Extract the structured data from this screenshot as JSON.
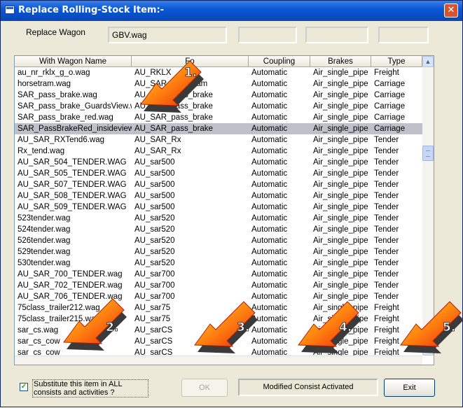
{
  "window": {
    "title": "Replace Rolling-Stock Item:-",
    "close_glyph": "✕"
  },
  "replace": {
    "label": "Replace Wagon",
    "value": "GBV.wag",
    "extra_box_1": "",
    "extra_box_2": "",
    "extra_box_3": ""
  },
  "list": {
    "columns": [
      "With Wagon Name",
      "Fo",
      "Coupling",
      "Brakes",
      "Type"
    ],
    "selected_index": 5,
    "rows": [
      [
        "au_nr_rklx_g_o.wag",
        "AU_RKLX",
        "Automatic",
        "Air_single_pipe",
        "Freight"
      ],
      [
        "horsetram.wag",
        "AU_SAR_horsetram",
        "Automatic",
        "Air_single_pipe",
        "Carriage"
      ],
      [
        "SAR_pass_brake.wag",
        "AU_SAR_pass_brake",
        "Automatic",
        "Air_single_pipe",
        "Carriage"
      ],
      [
        "SAR_pass_brake_GuardsView.wag",
        "AU_SAR_pass_brake",
        "Automatic",
        "Air_single_pipe",
        "Carriage"
      ],
      [
        "SAR_pass_brake_red.wag",
        "AU_SAR_pass_brake",
        "Automatic",
        "Air_single_pipe",
        "Carriage"
      ],
      [
        "SAR_PassBrakeRed_insideview.wag",
        "AU_SAR_pass_brake",
        "Automatic",
        "Air_single_pipe",
        "Carriage"
      ],
      [
        "AU_SAR_RXTend6.wag",
        "AU_SAR_Rx",
        "Automatic",
        "Air_single_pipe",
        "Tender"
      ],
      [
        "Rx_tend.wag",
        "AU_SAR_Rx",
        "Automatic",
        "Air_single_pipe",
        "Tender"
      ],
      [
        "AU_SAR_504_TENDER.WAG",
        "AU_sar500",
        "Automatic",
        "Air_single_pipe",
        "Tender"
      ],
      [
        "AU_SAR_505_TENDER.WAG",
        "AU_sar500",
        "Automatic",
        "Air_single_pipe",
        "Tender"
      ],
      [
        "AU_SAR_507_TENDER.WAG",
        "AU_sar500",
        "Automatic",
        "Air_single_pipe",
        "Tender"
      ],
      [
        "AU_SAR_508_TENDER.WAG",
        "AU_sar500",
        "Automatic",
        "Air_single_pipe",
        "Tender"
      ],
      [
        "AU_SAR_509_TENDER.WAG",
        "AU_sar500",
        "Automatic",
        "Air_single_pipe",
        "Tender"
      ],
      [
        "523tender.wag",
        "AU_sar520",
        "Automatic",
        "Air_single_pipe",
        "Tender"
      ],
      [
        "524tender.wag",
        "AU_sar520",
        "Automatic",
        "Air_single_pipe",
        "Tender"
      ],
      [
        "526tender.wag",
        "AU_sar520",
        "Automatic",
        "Air_single_pipe",
        "Tender"
      ],
      [
        "529tender.wag",
        "AU_sar520",
        "Automatic",
        "Air_single_pipe",
        "Tender"
      ],
      [
        "530tender.wag",
        "AU_sar520",
        "Automatic",
        "Air_single_pipe",
        "Tender"
      ],
      [
        "AU_SAR_700_TENDER.wag",
        "AU_sar700",
        "Automatic",
        "Air_single_pipe",
        "Tender"
      ],
      [
        "AU_SAR_702_TENDER.wag",
        "AU_sar700",
        "Automatic",
        "Air_single_pipe",
        "Tender"
      ],
      [
        "AU_SAR_706_TENDER.wag",
        "AU_sar700",
        "Automatic",
        "Air_single_pipe",
        "Tender"
      ],
      [
        "75class_trailer212.wag",
        "AU_sar75",
        "Automatic",
        "Air_single_pipe",
        "Freight"
      ],
      [
        "75class_trailer215.wag",
        "AU_sar75",
        "Automatic",
        "Air_single_pipe",
        "Freight"
      ],
      [
        "sar_cs.wag",
        "AU_sarCS",
        "Automatic",
        "Air_single_pipe",
        "Freight"
      ],
      [
        "sar_cs_cow",
        "AU_sarCS",
        "Automatic",
        "Air_single_pipe",
        "Freight"
      ],
      [
        "sar_cs_cow",
        "AU_sarCS",
        "Automatic",
        "Air_single_pipe",
        "Freight"
      ]
    ]
  },
  "options": {
    "substitute_label": "Substitute this item in ALL consists and activities ?",
    "substitute_checked": true,
    "check_glyph": "✓"
  },
  "buttons": {
    "ok": "OK",
    "exit": "Exit"
  },
  "status": {
    "text": "Modified Consist Activated"
  },
  "scrollbar": {
    "up_glyph": "▲",
    "down_glyph": "▼"
  },
  "annotations": {
    "arrow_labels": [
      "1.",
      "2.",
      "3.",
      "4.",
      "5."
    ],
    "arrow_color": "#e8400c"
  }
}
